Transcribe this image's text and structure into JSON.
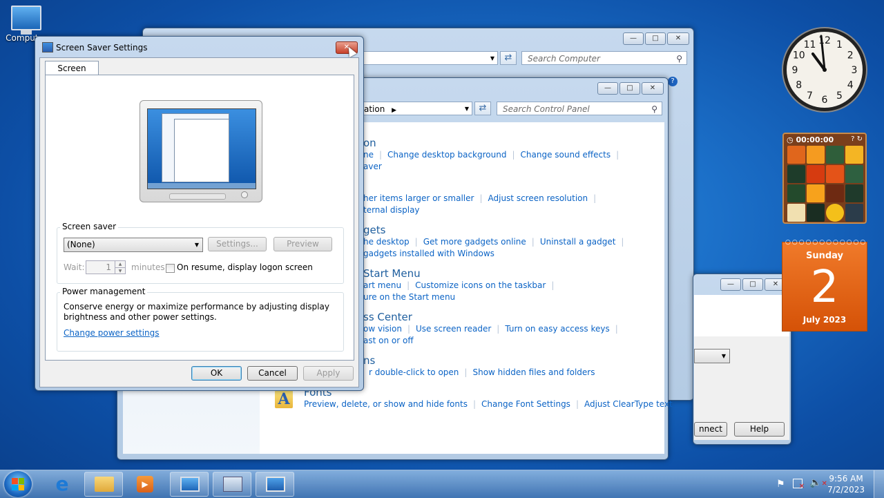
{
  "desktop": {
    "computer_icon_label": "Computer"
  },
  "explorer": {
    "search_placeholder": "Search Computer"
  },
  "control_panel": {
    "address_tail": "ation",
    "search_placeholder": "Search Control Panel",
    "categories": [
      {
        "title": "on",
        "links": [
          "ne",
          "Change desktop background",
          "Change sound effects"
        ],
        "sublinks": [
          "aver"
        ]
      },
      {
        "title": "",
        "links": [
          "her items larger or smaller",
          "Adjust screen resolution"
        ],
        "sublinks": [
          "ternal display"
        ]
      },
      {
        "title": "gets",
        "links": [
          "he desktop",
          "Get more gadgets online",
          "Uninstall a gadget"
        ],
        "sublinks": [
          "gadgets installed with Windows"
        ]
      },
      {
        "title": "Start Menu",
        "links": [
          "art menu",
          "Customize icons on the taskbar"
        ],
        "sublinks": [
          "ure on the Start menu"
        ]
      },
      {
        "title": "ss Center",
        "links": [
          "ow vision",
          "Use screen reader",
          "Turn on easy access keys"
        ],
        "sublinks": [
          "ast on or off"
        ]
      },
      {
        "title": "ns",
        "links": [
          "r double-click to open",
          "Show hidden files and folders"
        ],
        "sublinks": []
      },
      {
        "title": "Fonts",
        "links": [
          "Preview, delete, or show and hide fonts",
          "Change Font Settings",
          "Adjust ClearType text"
        ],
        "sublinks": []
      }
    ]
  },
  "back_dialog": {
    "connect_label": "nnect",
    "help_label": "Help"
  },
  "screensaver_dialog": {
    "title": "Screen Saver Settings",
    "tab": "Screen Saver",
    "screensaver_group": "Screen saver",
    "screensaver_selected": "(None)",
    "settings_label": "Settings...",
    "preview_label": "Preview",
    "wait_label": "Wait:",
    "wait_value": "1",
    "minutes_label": "minutes",
    "resume_label": "On resume, display logon screen",
    "power_group": "Power management",
    "power_text_line1": "Conserve energy or maximize performance by adjusting display",
    "power_text_line2": "brightness and other power settings.",
    "power_link": "Change power settings",
    "ok_label": "OK",
    "cancel_label": "Cancel",
    "apply_label": "Apply"
  },
  "gadgets": {
    "clock": {
      "numerals": [
        "12",
        "1",
        "2",
        "3",
        "4",
        "5",
        "6",
        "7",
        "8",
        "9",
        "10",
        "11"
      ]
    },
    "puzzle": {
      "timer": "00:00:00"
    },
    "calendar": {
      "weekday": "Sunday",
      "day": "2",
      "month_year": "July 2023"
    }
  },
  "taskbar": {
    "time": "9:56 AM",
    "date": "7/2/2023"
  }
}
